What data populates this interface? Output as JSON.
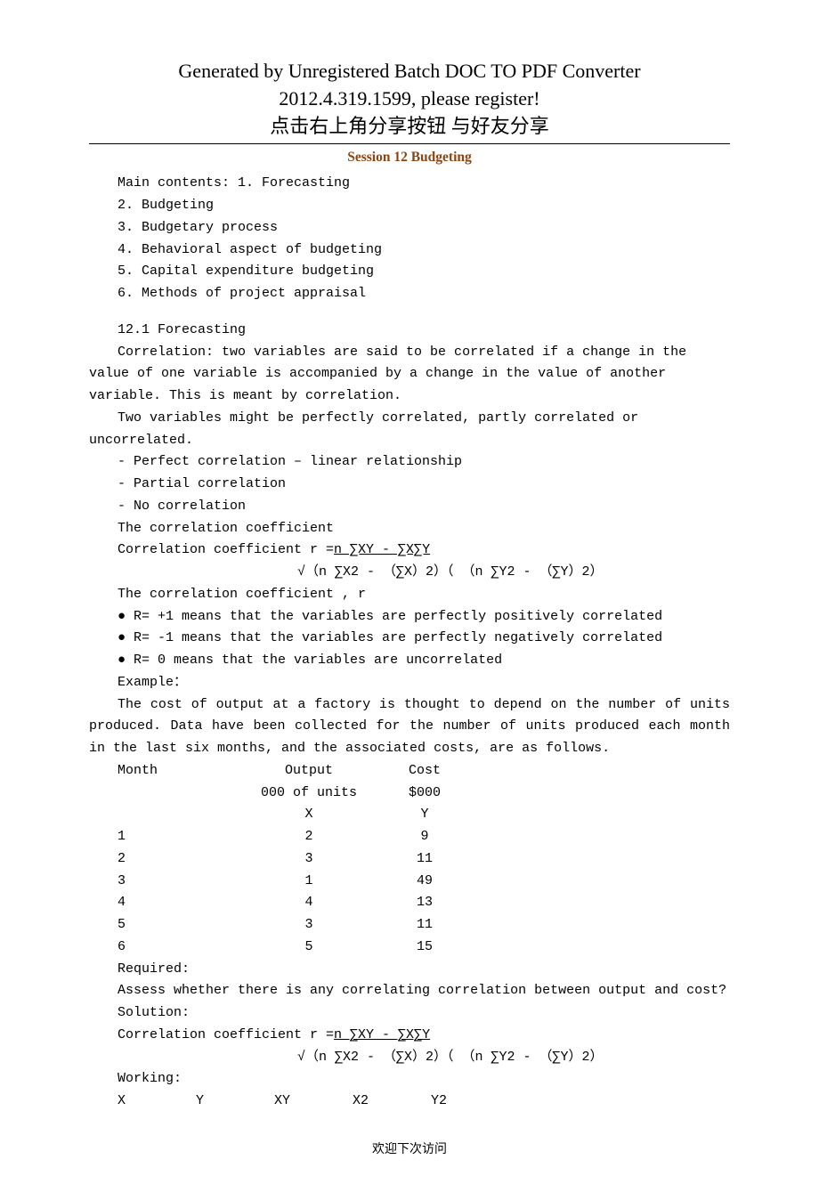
{
  "header": {
    "line1": "Generated by Unregistered Batch DOC TO PDF Converter",
    "line2": "2012.4.319.1599, please register!",
    "line3_cn": "点击右上角分享按钮 与好友分享"
  },
  "session_title": "Session 12 Budgeting",
  "toc": {
    "intro": "Main contents: 1. Forecasting",
    "items": [
      "2. Budgeting",
      "3. Budgetary process",
      "4. Behavioral aspect of budgeting",
      "5. Capital expenditure budgeting",
      "6. Methods of project appraisal"
    ]
  },
  "section_heading": "12.1 Forecasting",
  "paragraphs": {
    "correlation_def": "Correlation: two variables are said to be correlated if a change in the value of one variable is accompanied by a change in the value of another variable. This is meant by correlation.",
    "two_vars": "Two variables might be perfectly correlated, partly correlated or uncorrelated.",
    "list_perfect": "- Perfect correlation – linear relationship",
    "list_partial": "- Partial correlation",
    "list_no": "- No correlation",
    "coef_heading": "The correlation coefficient",
    "coef_formula_lead": "Correlation coefficient r =",
    "coef_formula_num": "n ∑XY - ∑X∑Y                         ",
    "coef_formula_den": "√（n ∑X2 - （∑X）2）（ （n ∑Y2 - （∑Y）2）",
    "coef_r_heading": "The correlation coefficient , r",
    "bullet1": "R= +1 means that the variables are perfectly positively correlated",
    "bullet2": "R= -1 means that the variables are perfectly negatively correlated",
    "bullet3": "R= 0 means that the variables are uncorrelated",
    "example_label": "Example：",
    "example_text": "The cost of output at a factory is thought to depend on the number of units produced. Data have been collected for the number of units produced each month in the last six months, and the associated costs, are as follows."
  },
  "table": {
    "headers": {
      "month": "Month",
      "output": "Output",
      "cost": "Cost"
    },
    "subheaders": {
      "output": "000 of units",
      "cost": "$000"
    },
    "vars": {
      "x": "X",
      "y": "Y"
    },
    "rows": [
      {
        "month": "1",
        "x": "2",
        "y": "9"
      },
      {
        "month": "2",
        "x": "3",
        "y": "11"
      },
      {
        "month": "3",
        "x": "1",
        "y": "49"
      },
      {
        "month": "4",
        "x": "4",
        "y": "13"
      },
      {
        "month": "5",
        "x": "3",
        "y": "11"
      },
      {
        "month": "6",
        "x": "5",
        "y": "15"
      }
    ]
  },
  "required_label": "Required:",
  "required_text": "Assess whether there is any correlating correlation between output and cost?",
  "solution_label": "Solution:",
  "solution_formula_lead": "Correlation coefficient r =",
  "solution_formula_num": "n ∑XY - ∑X∑Y                 ",
  "solution_formula_den": "√（n ∑X2 - （∑X）2）（ （n ∑Y2 - （∑Y）2）",
  "working_label": "Working:",
  "working_cols": [
    "X",
    "Y",
    "XY",
    "X2",
    "Y2"
  ],
  "footer": "欢迎下次访问"
}
